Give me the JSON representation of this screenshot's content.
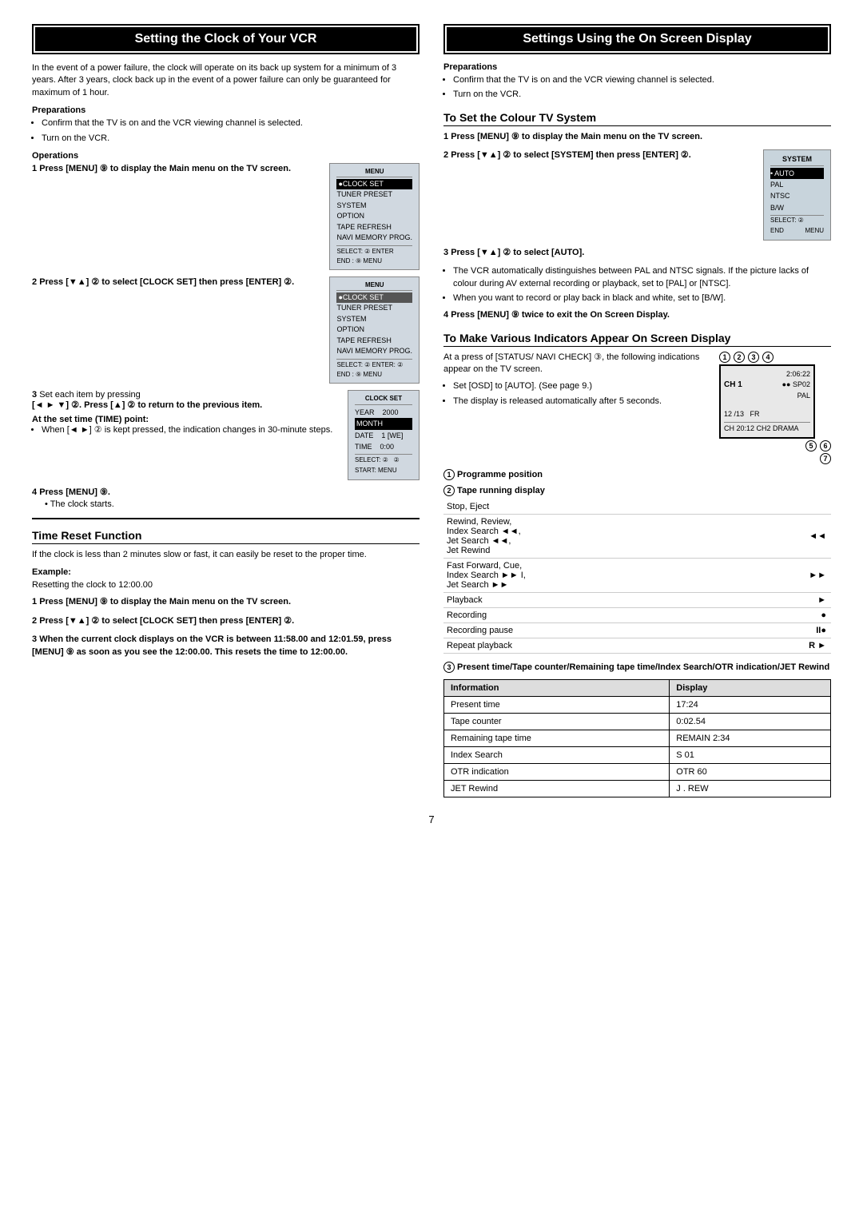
{
  "left": {
    "title": "Setting the Clock of Your VCR",
    "intro": "In the event of a power failure, the clock will operate on its back up system for a minimum of 3 years. After 3 years, clock back up in the event of a power failure can only be guaranteed for maximum of 1 hour.",
    "preparations_label": "Preparations",
    "prep_items": [
      "Confirm that the TV is on and the VCR viewing channel is selected.",
      "Turn on the VCR."
    ],
    "operations_label": "Operations",
    "steps": [
      {
        "num": "1",
        "text": "Press [MENU] ⑨ to display the Main menu on the TV screen."
      },
      {
        "num": "2",
        "text": "Press [▼▲] ② to select [CLOCK SET] then press [ENTER] ②."
      },
      {
        "num": "3",
        "text_parts": [
          "Set each item by pressing",
          "[◄ ► ▼] ②. Press [▲] ② to return to the previous item.",
          "At the set time (TIME) point:",
          "• When [◄ ►] ② is kept pressed, the indication changes in 30-minute steps."
        ]
      },
      {
        "num": "4",
        "text": "Press [MENU] ⑨.",
        "sub": "• The clock starts."
      }
    ],
    "time_reset_title": "Time Reset Function",
    "time_reset_intro": "If the clock is less than 2 minutes slow or fast, it can easily be reset to the proper time.",
    "example_label": "Example:",
    "example_text": "Resetting the clock to 12:00.00",
    "tr_steps": [
      {
        "num": "1",
        "text": "Press [MENU] ⑨ to display the Main menu on the TV screen."
      },
      {
        "num": "2",
        "text": "Press [▼▲] ② to select [CLOCK SET] then press [ENTER] ②."
      },
      {
        "num": "3",
        "text": "When the current clock displays on the VCR is between 11:58.00 and 12:01.59, press [MENU] ⑨ as soon as you see the 12:00.00. This resets the time to 12:00.00."
      }
    ]
  },
  "right": {
    "title": "Settings Using the On Screen Display",
    "preparations_label": "Preparations",
    "prep_items": [
      "Confirm that the TV is on and the VCR viewing channel is selected.",
      "Turn on the VCR."
    ],
    "colour_tv_title": "To Set the Colour TV System",
    "colour_steps": [
      {
        "num": "1",
        "text": "Press [MENU] ⑨ to display the Main menu on the TV screen."
      },
      {
        "num": "2",
        "text": "Press [▼▲] ② to select [SYSTEM] then press [ENTER] ②."
      },
      {
        "num": "3",
        "text": "Press [▼▲] ② to select [AUTO]."
      }
    ],
    "auto_notes": [
      "The VCR automatically distinguishes between PAL and NTSC signals. If the picture lacks of colour during AV external recording or playback, set to [PAL] or [NTSC].",
      "When you want to record or play back in black and white, set to [B/W]."
    ],
    "step4_text": "Press [MENU] ⑨ twice to exit the On Screen Display.",
    "indicators_title": "To Make Various Indicators Appear On Screen Display",
    "indicators_intro": "At a press of [STATUS/ NAVI CHECK] ③, the following indications appear on the TV screen.",
    "indicator_notes": [
      "Set [OSD] to [AUTO]. (See page 9.)",
      "The display is released automatically after 5 seconds."
    ],
    "prog_pos_label": "① Programme position",
    "tape_running_label": "② Tape running display",
    "tape_rows": [
      {
        "description": "Stop, Eject",
        "symbol": ""
      },
      {
        "description": "Rewind, Review,\nIndex Search ◄◄,\nJet Search ◄◄,\nJet Rewind",
        "symbol": "◄◄"
      },
      {
        "description": "Fast Forward, Cue,\nIndex Search ►► I,\nJet Search ►►",
        "symbol": "►►"
      },
      {
        "description": "Playback",
        "symbol": "►"
      },
      {
        "description": "Recording",
        "symbol": "●"
      },
      {
        "description": "Recording pause",
        "symbol": "II●"
      },
      {
        "description": "Repeat playback",
        "symbol": "R ►"
      }
    ],
    "present_time_label": "③ Present time/Tape counter/Remaining tape time/Index Search/OTR indication/JET Rewind",
    "info_table_headers": [
      "Information",
      "Display"
    ],
    "info_rows": [
      {
        "info": "Present time",
        "display": "17:24"
      },
      {
        "info": "Tape counter",
        "display": "0:02.54"
      },
      {
        "info": "Remaining tape time",
        "display": "REMAIN 2:34"
      },
      {
        "info": "Index Search",
        "display": "S 01"
      },
      {
        "info": "OTR indication",
        "display": "OTR 60"
      },
      {
        "info": "JET Rewind",
        "display": "J . REW"
      }
    ]
  },
  "page_number": "7",
  "menu_screen1": {
    "items": [
      "CLOCK SET",
      "TUNER PRESET",
      "SYSTEM",
      "OPTION",
      "TAPE REFRESH",
      "NAVI MEMORY PROG."
    ],
    "selected": "CLOCK SET",
    "footer": "SELECT: ②  ENTER",
    "footer2": "END    : ⑨  MENU"
  },
  "menu_screen2": {
    "items": [
      "CLOCK SET",
      "TUNER PRESET",
      "SYSTEM",
      "OPTION",
      "TAPE REFRESH",
      "NAVI MEMORY PROG."
    ],
    "selected": "CLOCK SET",
    "footer": "SELECT: ②  ENTER: ②",
    "footer2": "END    : ⑨  MENU"
  },
  "clock_screen": {
    "rows": [
      "YEAR    2000",
      "MONTH",
      "DATE    1 [WE]",
      "TIME    0:00"
    ],
    "footer": "SELECT: ②  ②",
    "footer2": "START: MENU"
  },
  "system_screen": {
    "title": "SYSTEM",
    "items": [
      "• AUTO",
      "PAL",
      "NTSC",
      "B/W"
    ],
    "selected": "• AUTO",
    "footer": "SELECT: ②",
    "footer2": "END    MENU"
  },
  "osd_diagram": {
    "annotations": [
      "①",
      "②",
      "③",
      "④",
      "⑤",
      "⑥",
      "⑦"
    ],
    "ch": "CH 1",
    "time": "2:06:22",
    "sp_ep": "●● SP02",
    "pal": "PAL",
    "date_bottom": "12/13   FR",
    "ch2": "CH 20:12 CH2 DRAMA"
  }
}
